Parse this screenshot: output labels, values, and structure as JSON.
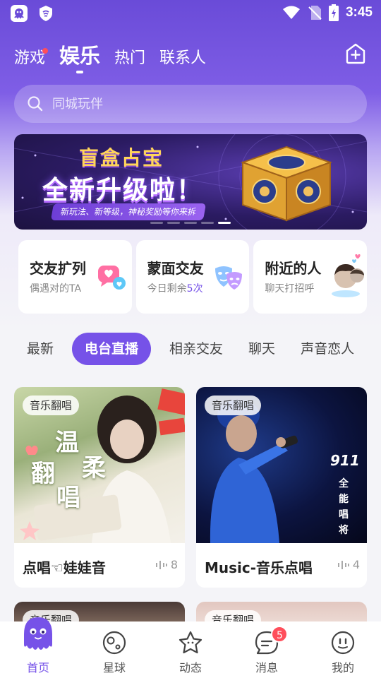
{
  "status_bar": {
    "time": "3:45",
    "icons": [
      "app-icon",
      "shield-icon",
      "wifi-icon",
      "no-sim-icon",
      "battery-charging-icon"
    ]
  },
  "top_tabs": [
    {
      "label": "游戏",
      "has_dot": true
    },
    {
      "label": "娱乐",
      "active": true
    },
    {
      "label": "热门"
    },
    {
      "label": "联系人"
    }
  ],
  "search": {
    "placeholder": "同城玩伴"
  },
  "banner": {
    "title": "盲盒占宝",
    "subtitle": "全新升级啦！",
    "description": "新玩法、新等级，神秘奖励等你来拆",
    "page_count": 5,
    "active_index": 4
  },
  "features": [
    {
      "title": "交友扩列",
      "subtitle": "偶遇对的TA",
      "icon": "chat-hearts-icon"
    },
    {
      "title": "蒙面交友",
      "subtitle_prefix": "今日剩余",
      "subtitle_highlight": "5次",
      "icon": "mask-icon"
    },
    {
      "title": "附近的人",
      "subtitle": "聊天打招呼",
      "icon": "avatar-icon"
    }
  ],
  "categories": [
    {
      "label": "最新"
    },
    {
      "label": "电台直播",
      "active": true
    },
    {
      "label": "相亲交友"
    },
    {
      "label": "聊天"
    },
    {
      "label": "声音恋人"
    }
  ],
  "rooms": [
    {
      "tag": "音乐翻唱",
      "title": "点唱☜娃娃音",
      "listeners": "8",
      "cover_text": [
        "温",
        "柔",
        "翻",
        "唱"
      ]
    },
    {
      "tag": "音乐翻唱",
      "title": "Music-音乐点唱",
      "listeners": "4",
      "cover_text": [
        "911",
        "全",
        "能",
        "唱",
        "将"
      ]
    },
    {
      "tag": "音乐翻唱"
    },
    {
      "tag": "音乐翻唱"
    }
  ],
  "tab_bar": [
    {
      "label": "首页",
      "icon": "mascot-icon",
      "active": true
    },
    {
      "label": "星球",
      "icon": "planet-icon"
    },
    {
      "label": "动态",
      "icon": "star-face-icon"
    },
    {
      "label": "消息",
      "icon": "message-icon",
      "badge": "5"
    },
    {
      "label": "我的",
      "icon": "smile-face-icon"
    }
  ],
  "colors": {
    "accent": "#7652e8",
    "header": "#6a4bd8",
    "badge": "#ff4e5b"
  }
}
